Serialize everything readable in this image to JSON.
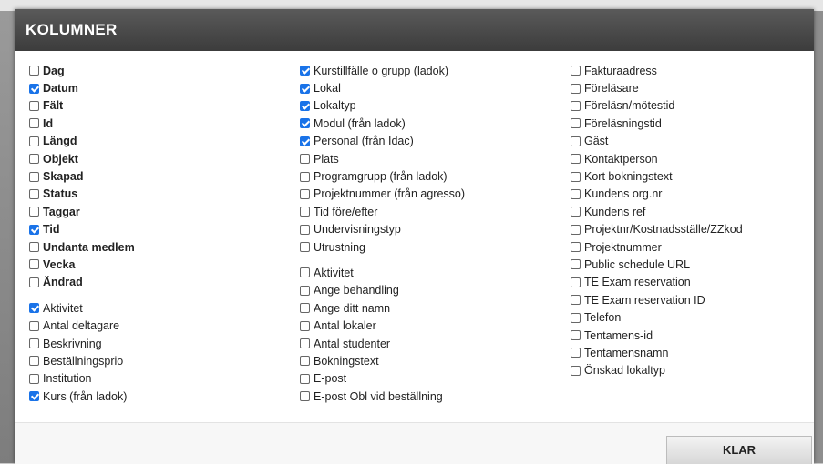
{
  "dialog": {
    "title": "KOLUMNER",
    "done_button": "KLAR"
  },
  "accent_color": "#1a73e8",
  "columns": [
    [
      {
        "label": "Dag",
        "checked": false,
        "bold": true
      },
      {
        "label": "Datum",
        "checked": true,
        "bold": true
      },
      {
        "label": "Fält",
        "checked": false,
        "bold": true
      },
      {
        "label": "Id",
        "checked": false,
        "bold": true
      },
      {
        "label": "Längd",
        "checked": false,
        "bold": true
      },
      {
        "label": "Objekt",
        "checked": false,
        "bold": true
      },
      {
        "label": "Skapad",
        "checked": false,
        "bold": true
      },
      {
        "label": "Status",
        "checked": false,
        "bold": true
      },
      {
        "label": "Taggar",
        "checked": false,
        "bold": true
      },
      {
        "label": "Tid",
        "checked": true,
        "bold": true
      },
      {
        "label": "Undanta medlem",
        "checked": false,
        "bold": true
      },
      {
        "label": "Vecka",
        "checked": false,
        "bold": true
      },
      {
        "label": "Ändrad",
        "checked": false,
        "bold": true
      },
      {
        "gap": true
      },
      {
        "label": "Aktivitet",
        "checked": true,
        "bold": false
      },
      {
        "label": "Antal deltagare",
        "checked": false,
        "bold": false
      },
      {
        "label": "Beskrivning",
        "checked": false,
        "bold": false
      },
      {
        "label": "Beställningsprio",
        "checked": false,
        "bold": false
      },
      {
        "label": "Institution",
        "checked": false,
        "bold": false
      },
      {
        "label": "Kurs (från ladok)",
        "checked": true,
        "bold": false
      }
    ],
    [
      {
        "label": "Kurstillfälle o grupp (ladok)",
        "checked": true,
        "bold": false
      },
      {
        "label": "Lokal",
        "checked": true,
        "bold": false
      },
      {
        "label": "Lokaltyp",
        "checked": true,
        "bold": false
      },
      {
        "label": "Modul (från ladok)",
        "checked": true,
        "bold": false
      },
      {
        "label": "Personal (från Idac)",
        "checked": true,
        "bold": false
      },
      {
        "label": "Plats",
        "checked": false,
        "bold": false
      },
      {
        "label": "Programgrupp (från ladok)",
        "checked": false,
        "bold": false
      },
      {
        "label": "Projektnummer (från agresso)",
        "checked": false,
        "bold": false
      },
      {
        "label": "Tid före/efter",
        "checked": false,
        "bold": false
      },
      {
        "label": "Undervisningstyp",
        "checked": false,
        "bold": false
      },
      {
        "label": "Utrustning",
        "checked": false,
        "bold": false
      },
      {
        "gap": true
      },
      {
        "label": "Aktivitet",
        "checked": false,
        "bold": false
      },
      {
        "label": "Ange behandling",
        "checked": false,
        "bold": false
      },
      {
        "label": "Ange ditt namn",
        "checked": false,
        "bold": false
      },
      {
        "label": "Antal lokaler",
        "checked": false,
        "bold": false
      },
      {
        "label": "Antal studenter",
        "checked": false,
        "bold": false
      },
      {
        "label": "Bokningstext",
        "checked": false,
        "bold": false
      },
      {
        "label": "E-post",
        "checked": false,
        "bold": false
      },
      {
        "label": "E-post Obl vid beställning",
        "checked": false,
        "bold": false
      }
    ],
    [
      {
        "label": "Fakturaadress",
        "checked": false,
        "bold": false
      },
      {
        "label": "Föreläsare",
        "checked": false,
        "bold": false
      },
      {
        "label": "Föreläsn/mötestid",
        "checked": false,
        "bold": false
      },
      {
        "label": "Föreläsningstid",
        "checked": false,
        "bold": false
      },
      {
        "label": "Gäst",
        "checked": false,
        "bold": false
      },
      {
        "label": "Kontaktperson",
        "checked": false,
        "bold": false
      },
      {
        "label": "Kort bokningstext",
        "checked": false,
        "bold": false
      },
      {
        "label": "Kundens org.nr",
        "checked": false,
        "bold": false
      },
      {
        "label": "Kundens ref",
        "checked": false,
        "bold": false
      },
      {
        "label": "Projektnr/Kostnadsställe/ZZkod",
        "checked": false,
        "bold": false
      },
      {
        "label": "Projektnummer",
        "checked": false,
        "bold": false
      },
      {
        "label": "Public schedule URL",
        "checked": false,
        "bold": false
      },
      {
        "label": "TE Exam reservation",
        "checked": false,
        "bold": false
      },
      {
        "label": "TE Exam reservation ID",
        "checked": false,
        "bold": false
      },
      {
        "label": "Telefon",
        "checked": false,
        "bold": false
      },
      {
        "label": "Tentamens-id",
        "checked": false,
        "bold": false
      },
      {
        "label": "Tentamensnamn",
        "checked": false,
        "bold": false
      },
      {
        "label": "Önskad lokaltyp",
        "checked": false,
        "bold": false
      }
    ]
  ]
}
